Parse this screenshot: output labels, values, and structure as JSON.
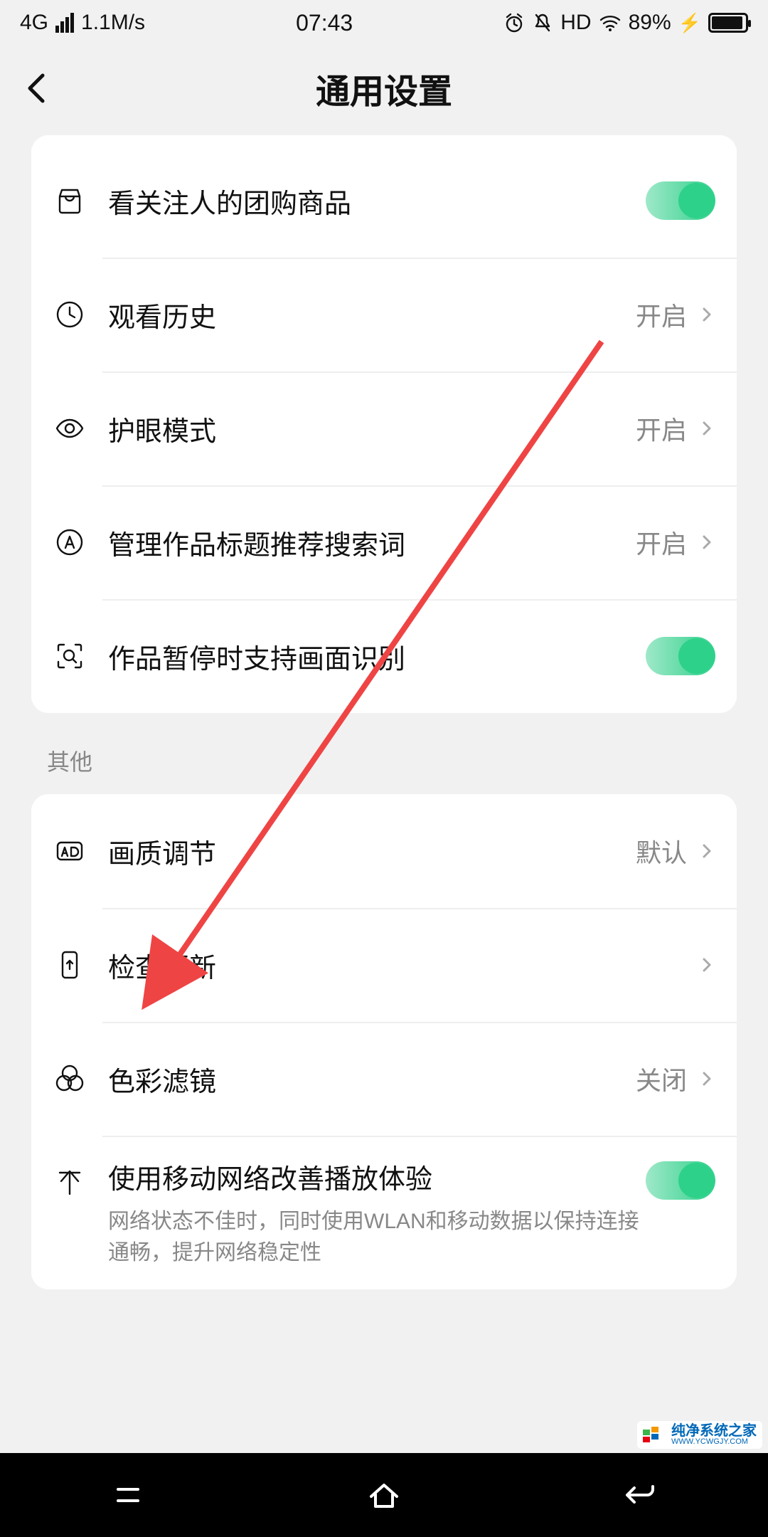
{
  "status": {
    "network": "4G",
    "speed": "1.1M/s",
    "time": "07:43",
    "hd": "HD",
    "battery_pct": "89%"
  },
  "header": {
    "title": "通用设置"
  },
  "group1": {
    "follow_group_buy": {
      "label": "看关注人的团购商品",
      "on": true
    },
    "watch_history": {
      "label": "观看历史",
      "value": "开启"
    },
    "eye_protect": {
      "label": "护眼模式",
      "value": "开启"
    },
    "title_keywords": {
      "label": "管理作品标题推荐搜索词",
      "value": "开启"
    },
    "pause_recognition": {
      "label": "作品暂停时支持画面识别",
      "on": true
    }
  },
  "group2_header": "其他",
  "group2": {
    "quality_adjust": {
      "label": "画质调节",
      "value": "默认"
    },
    "check_update": {
      "label": "检查更新"
    },
    "color_filter": {
      "label": "色彩滤镜",
      "value": "关闭"
    },
    "mobile_boost": {
      "label": "使用移动网络改善播放体验",
      "sub": "网络状态不佳时，同时使用WLAN和移动数据以保持连接通畅，提升网络稳定性",
      "on": true
    }
  },
  "watermark": {
    "cn": "纯净系统之家",
    "en": "WWW.YCWGJY.COM"
  }
}
